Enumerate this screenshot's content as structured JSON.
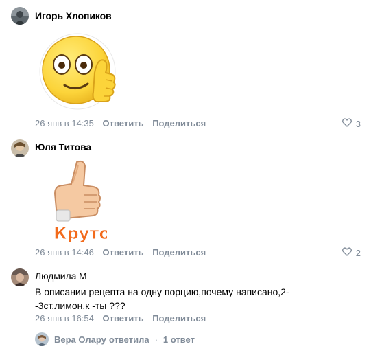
{
  "comments": [
    {
      "author": "Игорь Хлопиков",
      "date": "26 янв в 14:35",
      "reply_label": "Ответить",
      "share_label": "Поделиться",
      "likes": "3",
      "sticker": "smiley-thumbs-up"
    },
    {
      "author": "Юля Титова",
      "date": "26 янв в 14:46",
      "reply_label": "Ответить",
      "share_label": "Поделиться",
      "likes": "2",
      "sticker": "thumbs-up-kruto",
      "sticker_text": "Круто"
    },
    {
      "author": "Людмила М",
      "text_line1": "В описании рецепта на одну порцию,почему написано,2-",
      "text_line2": "-3ст.лимон.к -ты ???",
      "date": "26 янв в 16:54",
      "reply_label": "Ответить",
      "share_label": "Поделиться"
    }
  ],
  "replies": {
    "author": "Вера Олару",
    "action": "ответила",
    "separator": "·",
    "count": "1 ответ"
  },
  "colors": {
    "meta": "#818c99",
    "text": "#000000",
    "background": "#ffffff"
  }
}
